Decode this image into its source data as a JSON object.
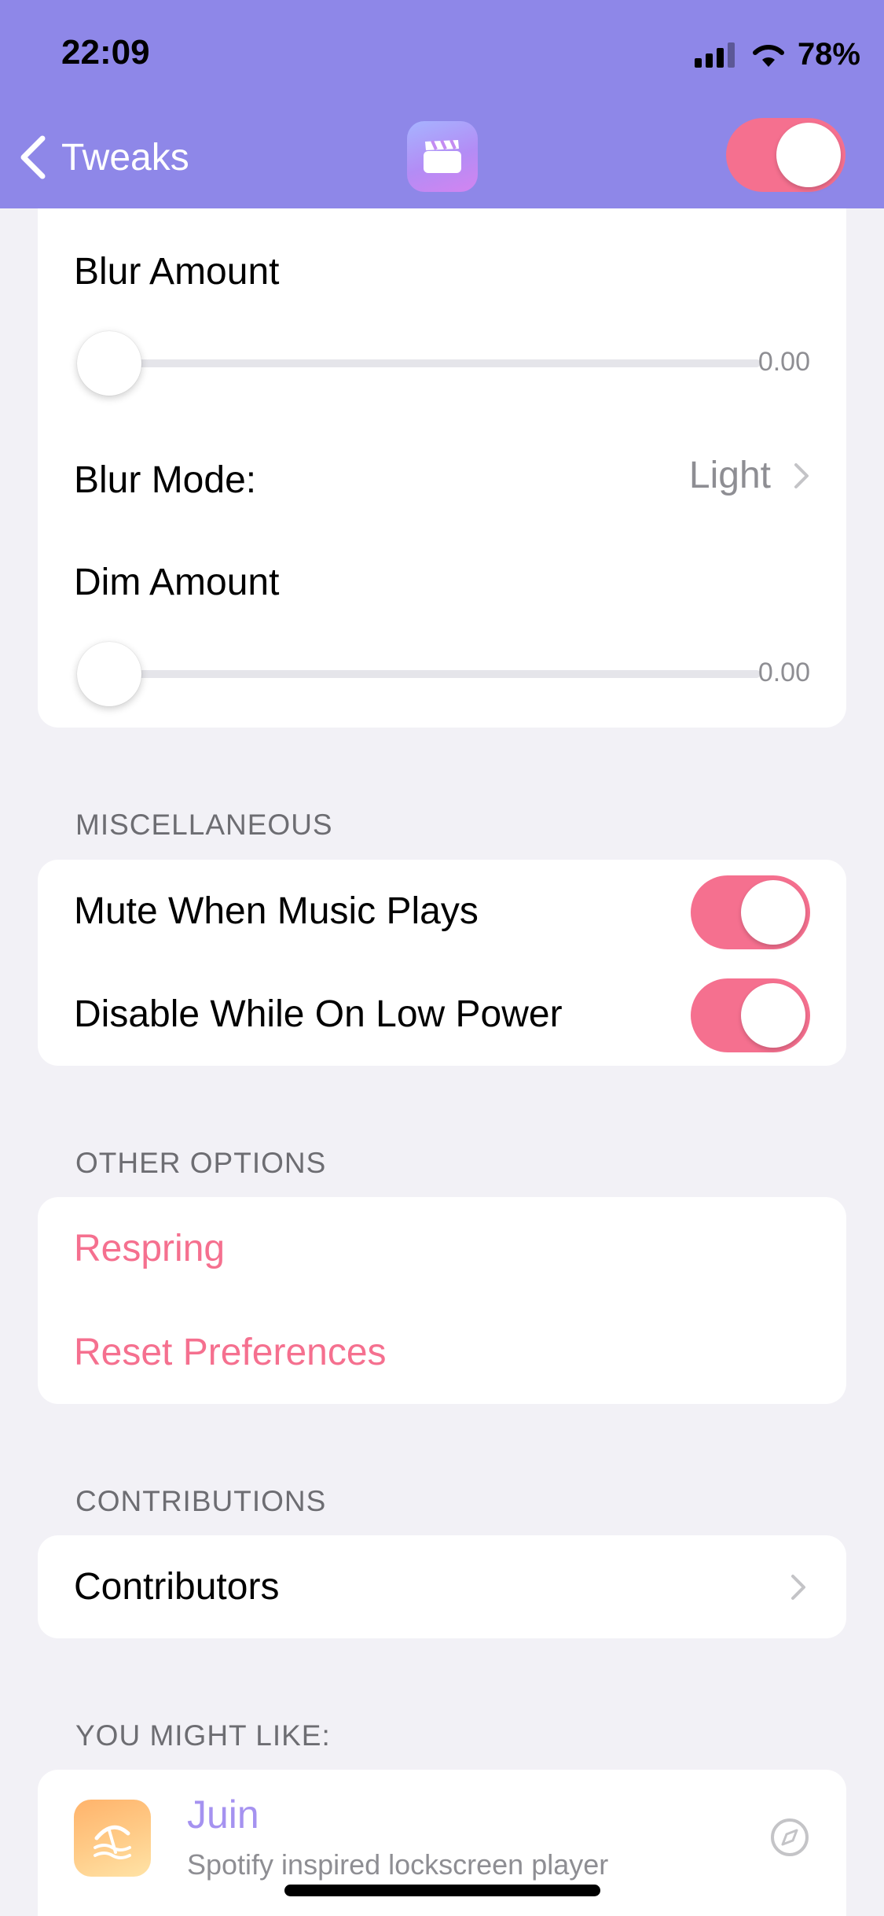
{
  "status_bar": {
    "time": "22:09",
    "battery": "78%",
    "signal_icon": "cellular-signal-icon",
    "wifi_icon": "wifi-icon"
  },
  "nav": {
    "back_label": "Tweaks",
    "back_icon": "chevron-left-icon",
    "app_icon": "clapperboard-icon",
    "enabled": true
  },
  "blur_section": {
    "blur_amount_label": "Blur Amount",
    "blur_amount_value": "0.00",
    "blur_mode_label": "Blur Mode:",
    "blur_mode_value": "Light",
    "dim_amount_label": "Dim Amount",
    "dim_amount_value": "0.00"
  },
  "misc_section": {
    "header": "MISCELLANEOUS",
    "mute_label": "Mute When Music Plays",
    "mute_enabled": true,
    "low_power_label": "Disable While On Low Power",
    "low_power_enabled": true
  },
  "other_section": {
    "header": "OTHER OPTIONS",
    "respring_label": "Respring",
    "reset_label": "Reset Preferences"
  },
  "contrib_section": {
    "header": "CONTRIBUTIONS",
    "contributors_label": "Contributors"
  },
  "suggest_section": {
    "header": "YOU MIGHT LIKE:",
    "package_name": "Juin",
    "package_desc": "Spotify inspired lockscreen player"
  },
  "colors": {
    "header_bg": "#8E87E8",
    "accent_pink": "#F5708F",
    "accent_purple": "#A592F0",
    "background": "#F2F1F6"
  }
}
